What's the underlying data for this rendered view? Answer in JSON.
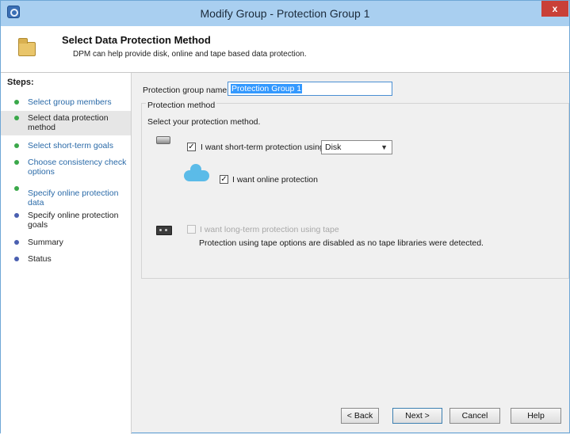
{
  "window": {
    "title": "Modify Group - Protection Group 1",
    "close_glyph": "x"
  },
  "header": {
    "title": "Select Data Protection Method",
    "subtitle": "DPM can help provide disk, online and tape based data protection."
  },
  "steps": {
    "title": "Steps:",
    "items": [
      {
        "label": "Select group members",
        "state": "done"
      },
      {
        "label": "Select data protection method",
        "state": "current"
      },
      {
        "label": "Select short-term goals",
        "state": "done"
      },
      {
        "label": "Choose consistency check options",
        "state": "done"
      },
      {
        "label": "Specify online protection data",
        "state": "done"
      },
      {
        "label": "Specify online protection goals",
        "state": "todo"
      },
      {
        "label": "Summary",
        "state": "todo"
      },
      {
        "label": "Status",
        "state": "todo"
      }
    ]
  },
  "form": {
    "group_name_label": "Protection group name:",
    "group_name_value": "Protection Group 1",
    "method_legend": "Protection method",
    "method_prompt": "Select your protection method.",
    "short_term": {
      "label": "I want short-term protection using:",
      "checked": true,
      "selected_option": "Disk"
    },
    "online": {
      "label": "I want online protection",
      "checked": true
    },
    "tape": {
      "label": "I want long-term protection using tape",
      "checked": false,
      "enabled": false,
      "note": "Protection using tape options are disabled as no tape libraries were detected."
    }
  },
  "buttons": {
    "back": "< Back",
    "next": "Next >",
    "cancel": "Cancel",
    "help": "Help"
  },
  "colors": {
    "titlebar": "#a9cff0",
    "close": "#c94038",
    "done_bullet": "#3aa84a",
    "todo_bullet": "#4a5fb0",
    "link": "#2a6aa8"
  }
}
